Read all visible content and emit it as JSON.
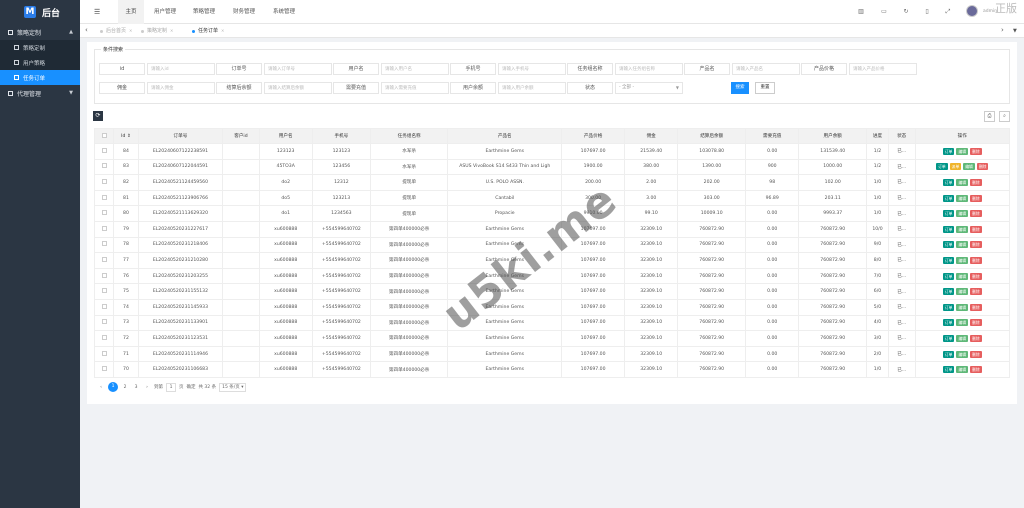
{
  "sidebar": {
    "logo": "后台",
    "logo_mark": "M",
    "groups": [
      {
        "label": "策略定制",
        "items": [
          "策略定制",
          "用户策略",
          "任务订单"
        ],
        "active": "任务订单"
      },
      {
        "label": "代理管理"
      }
    ]
  },
  "topbar": {
    "tabs": [
      "主页",
      "用户管理",
      "策略管理",
      "财务管理",
      "系统管理"
    ],
    "active": "主页",
    "username": "admin",
    "corner_text": "正版"
  },
  "tabbar": {
    "tabs": [
      "后台首页",
      "策略定制",
      "任务订单"
    ],
    "active": "任务订单"
  },
  "search": {
    "title": "条件搜索",
    "fields_row1": [
      {
        "label": "id",
        "placeholder": "请输入id"
      },
      {
        "label": "订单号",
        "placeholder": "请输入订单号"
      },
      {
        "label": "用户名",
        "placeholder": "请输入用户名"
      },
      {
        "label": "手机号",
        "placeholder": "请输入手机号"
      },
      {
        "label": "任务组名称",
        "placeholder": "请输入任务组名称"
      },
      {
        "label": "产品名",
        "placeholder": "请输入产品名"
      },
      {
        "label": "产品价格",
        "placeholder": "请输入产品价格"
      }
    ],
    "fields_row2": [
      {
        "label": "佣金",
        "placeholder": "请输入佣金"
      },
      {
        "label": "结算后余额",
        "placeholder": "请输入结算后余额"
      },
      {
        "label": "需要充值",
        "placeholder": "请输入需要充值"
      },
      {
        "label": "用户余额",
        "placeholder": "请输入用户余额"
      },
      {
        "label": "状态",
        "select": "- 全部 -"
      }
    ],
    "search_btn": "搜索",
    "reset_btn": "重置"
  },
  "table": {
    "headers": [
      "",
      "Id",
      "订单号",
      "客户id",
      "用户名",
      "手机号",
      "任务组名称",
      "产品名",
      "产品价格",
      "佣金",
      "结算后余额",
      "需要充值",
      "用户余额",
      "进度",
      "状态",
      "操作"
    ],
    "rows": [
      [
        "84",
        "EL2024060712223859​1",
        "",
        "123123",
        "123123",
        "水军杀",
        "Earthmine Gems",
        "107697.00",
        "21539.40",
        "103078.80",
        "0.00",
        "131539.40",
        "1/2",
        "已..."
      ],
      [
        "83",
        "EL20240607122044591",
        "",
        "45TO3A",
        "123456",
        "水军杀",
        "ASUS VivoBook S14 S433 Thin and Ligh",
        "1900.00",
        "380.00",
        "1390.00",
        "900",
        "1000.00",
        "1/2",
        "已..."
      ],
      [
        "82",
        "EL20240521124459560",
        "",
        "do2",
        "12312",
        "提现单",
        "U.S. POLO ASSN.",
        "200.00",
        "2.00",
        "202.00",
        "98",
        "102.00",
        "1/0",
        "已..."
      ],
      [
        "81",
        "EL20240521123906766",
        "",
        "do5",
        "123213",
        "提现单",
        "Cantabil",
        "300.00",
        "3.00",
        "303.00",
        "96.89",
        "203.11",
        "1/0",
        "已..."
      ],
      [
        "80",
        "EL20240521113629320",
        "",
        "do1",
        "1234563",
        "提现单",
        "Propacie",
        "9910.00",
        "99.10",
        "10009.10",
        "0.00",
        "9993.37",
        "1/0",
        "已..."
      ],
      [
        "79",
        "EL20240520231227617",
        "",
        "xu600888",
        "+554599640702",
        "第四单400000必杀",
        "Earthmine Gems",
        "107697.00",
        "32309.10",
        "760872.90",
        "0.00",
        "760872.90",
        "10/0",
        "已..."
      ],
      [
        "78",
        "EL20240520231218406",
        "",
        "xu600888",
        "+554599640702",
        "第四单400000必杀",
        "Earthmine Gems",
        "107697.00",
        "32309.10",
        "760872.90",
        "0.00",
        "760872.90",
        "9/0",
        "已..."
      ],
      [
        "77",
        "EL20240520231210280",
        "",
        "xu600888",
        "+554599640702",
        "第四单400000必杀",
        "Earthmine Gems",
        "107697.00",
        "32309.10",
        "760872.90",
        "0.00",
        "760872.90",
        "8/0",
        "已..."
      ],
      [
        "76",
        "EL20240520231203255",
        "",
        "xu600888",
        "+554599640702",
        "第四单400000必杀",
        "Earthmine Gems",
        "107697.00",
        "32309.10",
        "760872.90",
        "0.00",
        "760872.90",
        "7/0",
        "已..."
      ],
      [
        "75",
        "EL20240520231155132",
        "",
        "xu600888",
        "+554599640702",
        "第四单400000必杀",
        "Earthmine Gems",
        "107697.00",
        "32309.10",
        "760872.90",
        "0.00",
        "760872.90",
        "6/0",
        "已..."
      ],
      [
        "74",
        "EL20240520231145933",
        "",
        "xu600888",
        "+554599640702",
        "第四单400000必杀",
        "Earthmine Gems",
        "107697.00",
        "32309.10",
        "760872.90",
        "0.00",
        "760872.90",
        "5/0",
        "已..."
      ],
      [
        "73",
        "EL20240520231133901",
        "",
        "xu600888",
        "+554599640702",
        "第四单400000必杀",
        "Earthmine Gems",
        "107697.00",
        "32309.10",
        "760872.90",
        "0.00",
        "760872.90",
        "4/0",
        "已..."
      ],
      [
        "72",
        "EL20240520231123531",
        "",
        "xu600888",
        "+554599640702",
        "第四单400000必杀",
        "Earthmine Gems",
        "107697.00",
        "32309.10",
        "760872.90",
        "0.00",
        "760872.90",
        "3/0",
        "已..."
      ],
      [
        "71",
        "EL20240520231114946",
        "",
        "xu600888",
        "+554599640702",
        "第四单400000必杀",
        "Earthmine Gems",
        "107697.00",
        "32309.10",
        "760872.90",
        "0.00",
        "760872.90",
        "2/0",
        "已..."
      ],
      [
        "70",
        "EL20240520231106683",
        "",
        "xu600888",
        "+554599640702",
        "第四单400000必杀",
        "Earthmine Gems",
        "107697.00",
        "32309.10",
        "760872.90",
        "0.00",
        "760872.90",
        "1/0",
        "已..."
      ]
    ],
    "op_labels": {
      "view": "订单",
      "edit": "编辑",
      "delete": "删除",
      "extra": "派单"
    }
  },
  "pager": {
    "pages": [
      "1",
      "2",
      "3"
    ],
    "active": "1",
    "goto_label": "到第",
    "goto_value": "1",
    "page_unit": "页",
    "confirm": "确定",
    "total": "共 32 条",
    "size": "15 条/页"
  },
  "watermark": "u5ki.me",
  "colors": {
    "primary": "#1890ff",
    "sidebar": "#2b3643",
    "teal": "#009688",
    "green": "#5fb878",
    "red": "#e65e5e"
  }
}
